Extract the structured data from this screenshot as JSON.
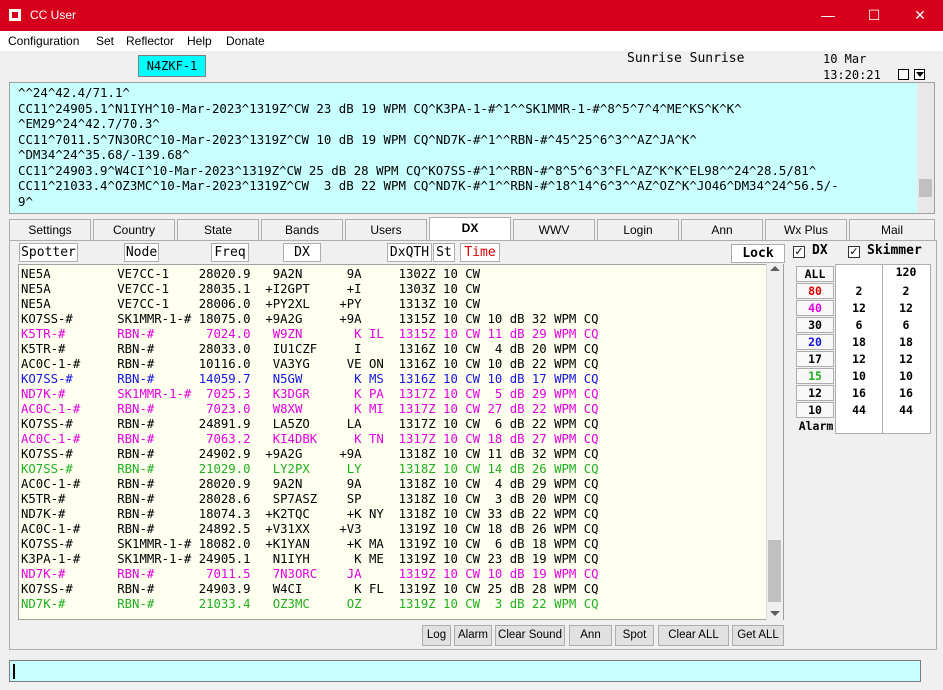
{
  "window": {
    "title": "CC User",
    "minimize": "—",
    "maximize": "☐",
    "close": "✕"
  },
  "menu": [
    "Configuration",
    "Set",
    "Reflector",
    "Help",
    "Donate"
  ],
  "callsign": "N4ZKF-1",
  "sun": "Sunrise Sunrise",
  "date": "10 Mar",
  "time": "13:20:21",
  "spot_log": [
    "^^24^42.4/71.1^",
    "CC11^24905.1^N1IYH^10-Mar-2023^1319Z^CW 23 dB 19 WPM CQ^K3PA-1-#^1^^SK1MMR-1-#^8^5^7^4^ME^KS^K^K^",
    "^EM29^24^42.7/70.3^",
    "CC11^7011.5^7N3ORC^10-Mar-2023^1319Z^CW 10 dB 19 WPM CQ^ND7K-#^1^^RBN-#^45^25^6^3^^AZ^JA^K^",
    "^DM34^24^35.68/-139.68^",
    "CC11^24903.9^W4CI^10-Mar-2023^1319Z^CW 25 dB 28 WPM CQ^KO7SS-#^1^^RBN-#^8^5^6^3^FL^AZ^K^K^EL98^^24^28.5/81^",
    "CC11^21033.4^OZ3MC^10-Mar-2023^1319Z^CW  3 dB 22 WPM CQ^ND7K-#^1^^RBN-#^18^14^6^3^^AZ^OZ^K^JO46^DM34^24^56.5/-",
    "9^"
  ],
  "tabs": [
    "Settings",
    "Country",
    "State",
    "Bands",
    "Users",
    "DX",
    "WWV",
    "Login",
    "Ann",
    "Wx Plus",
    "Mail"
  ],
  "active_tab": "DX",
  "headers": [
    "Spotter",
    "Node",
    "Freq",
    "DX",
    "DxQTH",
    "St",
    "Time"
  ],
  "lock": "Lock",
  "colors": {
    "black": "#000000",
    "magenta": "#e000e0",
    "blue": "#1414e0",
    "green": "#20b020",
    "time_header": "#e00000",
    "cyan": "#00ffff"
  },
  "rows": [
    {
      "spotter": "NE5A",
      "node": "VE7CC-1",
      "freq": "28020.9",
      "dx": " 9A2N",
      "qth": "9A",
      "st": "",
      "time": "1302Z",
      "band": "10",
      "mode": "CW",
      "extra": "",
      "color": "black"
    },
    {
      "spotter": "NE5A",
      "node": "VE7CC-1",
      "freq": "28035.1",
      "dx": "+I2GPT",
      "qth": "+I",
      "st": "",
      "time": "1303Z",
      "band": "10",
      "mode": "CW",
      "extra": "",
      "color": "black"
    },
    {
      "spotter": "NE5A",
      "node": "VE7CC-1",
      "freq": "28006.0",
      "dx": "+PY2XL",
      "qth": "+PY",
      "st": "",
      "time": "1313Z",
      "band": "10",
      "mode": "CW",
      "extra": "",
      "color": "black"
    },
    {
      "spotter": "KO7SS-#",
      "node": "SK1MMR-1-#",
      "freq": "18075.0",
      "dx": "+9A2G",
      "qth": "+9A",
      "st": "",
      "time": "1315Z",
      "band": "10",
      "mode": "CW",
      "extra": "10 dB 32 WPM CQ",
      "color": "black"
    },
    {
      "spotter": "K5TR-#",
      "node": "RBN-#",
      "freq": "7024.0",
      "dx": " W9ZN",
      "qth": "K",
      "st": "IL",
      "time": "1315Z",
      "band": "10",
      "mode": "CW",
      "extra": "11 dB 29 WPM CQ",
      "color": "magenta"
    },
    {
      "spotter": "K5TR-#",
      "node": "RBN-#",
      "freq": "28033.0",
      "dx": " IU1CZF",
      "qth": "I",
      "st": "",
      "time": "1316Z",
      "band": "10",
      "mode": "CW",
      "extra": " 4 dB 20 WPM CQ",
      "color": "black"
    },
    {
      "spotter": "AC0C-1-#",
      "node": "RBN-#",
      "freq": "10116.0",
      "dx": " VA3YG",
      "qth": "VE",
      "st": "ON",
      "time": "1316Z",
      "band": "10",
      "mode": "CW",
      "extra": "10 dB 22 WPM CQ",
      "color": "black"
    },
    {
      "spotter": "KO7SS-#",
      "node": "RBN-#",
      "freq": "14059.7",
      "dx": " N5GW",
      "qth": "K",
      "st": "MS",
      "time": "1316Z",
      "band": "10",
      "mode": "CW",
      "extra": "10 dB 17 WPM CQ",
      "color": "blue"
    },
    {
      "spotter": "ND7K-#",
      "node": "SK1MMR-1-#",
      "freq": "7025.3",
      "dx": " K3DGR",
      "qth": "K",
      "st": "PA",
      "time": "1317Z",
      "band": "10",
      "mode": "CW",
      "extra": " 5 dB 29 WPM CQ",
      "color": "magenta"
    },
    {
      "spotter": "AC0C-1-#",
      "node": "RBN-#",
      "freq": "7023.0",
      "dx": " W8XW",
      "qth": "K",
      "st": "MI",
      "time": "1317Z",
      "band": "10",
      "mode": "CW",
      "extra": "27 dB 22 WPM CQ",
      "color": "magenta"
    },
    {
      "spotter": "KO7SS-#",
      "node": "RBN-#",
      "freq": "24891.9",
      "dx": " LA5ZO",
      "qth": "LA",
      "st": "",
      "time": "1317Z",
      "band": "10",
      "mode": "CW",
      "extra": " 6 dB 22 WPM CQ",
      "color": "black"
    },
    {
      "spotter": "AC0C-1-#",
      "node": "RBN-#",
      "freq": "7063.2",
      "dx": " KI4DBK",
      "qth": "K",
      "st": "TN",
      "time": "1317Z",
      "band": "10",
      "mode": "CW",
      "extra": "18 dB 27 WPM CQ",
      "color": "magenta"
    },
    {
      "spotter": "KO7SS-#",
      "node": "RBN-#",
      "freq": "24902.9",
      "dx": "+9A2G",
      "qth": "+9A",
      "st": "",
      "time": "1318Z",
      "band": "10",
      "mode": "CW",
      "extra": "11 dB 32 WPM CQ",
      "color": "black"
    },
    {
      "spotter": "KO7SS-#",
      "node": "RBN-#",
      "freq": "21029.0",
      "dx": " LY2PX",
      "qth": "LY",
      "st": "",
      "time": "1318Z",
      "band": "10",
      "mode": "CW",
      "extra": "14 dB 26 WPM CQ",
      "color": "green"
    },
    {
      "spotter": "AC0C-1-#",
      "node": "RBN-#",
      "freq": "28020.9",
      "dx": " 9A2N",
      "qth": "9A",
      "st": "",
      "time": "1318Z",
      "band": "10",
      "mode": "CW",
      "extra": " 4 dB 29 WPM CQ",
      "color": "black"
    },
    {
      "spotter": "K5TR-#",
      "node": "RBN-#",
      "freq": "28028.6",
      "dx": " SP7ASZ",
      "qth": "SP",
      "st": "",
      "time": "1318Z",
      "band": "10",
      "mode": "CW",
      "extra": " 3 dB 20 WPM CQ",
      "color": "black"
    },
    {
      "spotter": "ND7K-#",
      "node": "RBN-#",
      "freq": "18074.3",
      "dx": "+K2TQC",
      "qth": "+K",
      "st": "NY",
      "time": "1318Z",
      "band": "10",
      "mode": "CW",
      "extra": "33 dB 22 WPM CQ",
      "color": "black"
    },
    {
      "spotter": "AC0C-1-#",
      "node": "RBN-#",
      "freq": "24892.5",
      "dx": "+V31XX",
      "qth": "+V3",
      "st": "",
      "time": "1319Z",
      "band": "10",
      "mode": "CW",
      "extra": "18 dB 26 WPM CQ",
      "color": "black"
    },
    {
      "spotter": "KO7SS-#",
      "node": "SK1MMR-1-#",
      "freq": "18082.0",
      "dx": "+K1YAN",
      "qth": "+K",
      "st": "MA",
      "time": "1319Z",
      "band": "10",
      "mode": "CW",
      "extra": " 6 dB 18 WPM CQ",
      "color": "black"
    },
    {
      "spotter": "K3PA-1-#",
      "node": "SK1MMR-1-#",
      "freq": "24905.1",
      "dx": " N1IYH",
      "qth": "K",
      "st": "ME",
      "time": "1319Z",
      "band": "10",
      "mode": "CW",
      "extra": "23 dB 19 WPM CQ",
      "color": "black"
    },
    {
      "spotter": "ND7K-#",
      "node": "RBN-#",
      "freq": "7011.5",
      "dx": " 7N3ORC",
      "qth": "JA",
      "st": "",
      "time": "1319Z",
      "band": "10",
      "mode": "CW",
      "extra": "10 dB 19 WPM CQ",
      "color": "magenta"
    },
    {
      "spotter": "KO7SS-#",
      "node": "RBN-#",
      "freq": "24903.9",
      "dx": " W4CI",
      "qth": "K",
      "st": "FL",
      "time": "1319Z",
      "band": "10",
      "mode": "CW",
      "extra": "25 dB 28 WPM CQ",
      "color": "black"
    },
    {
      "spotter": "ND7K-#",
      "node": "RBN-#",
      "freq": "21033.4",
      "dx": " OZ3MC",
      "qth": "OZ",
      "st": "",
      "time": "1319Z",
      "band": "10",
      "mode": "CW",
      "extra": " 3 dB 22 WPM CQ",
      "color": "green"
    }
  ],
  "filters": {
    "dx_label": "DX",
    "dx_checked": true,
    "skimmer_label": "Skimmer",
    "skimmer_checked": true,
    "check_mark": "✓"
  },
  "bands": [
    {
      "label": "ALL",
      "color": "black",
      "dx": "",
      "skim": "120"
    },
    {
      "label": "80",
      "color": "red",
      "dx": "2",
      "skim": "2"
    },
    {
      "label": "40",
      "color": "magenta",
      "dx": "12",
      "skim": "12"
    },
    {
      "label": "30",
      "color": "black",
      "dx": "6",
      "skim": "6"
    },
    {
      "label": "20",
      "color": "blue",
      "dx": "18",
      "skim": "18"
    },
    {
      "label": "17",
      "color": "black",
      "dx": "12",
      "skim": "12"
    },
    {
      "label": "15",
      "color": "green",
      "dx": "10",
      "skim": "10"
    },
    {
      "label": "12",
      "color": "black",
      "dx": "16",
      "skim": "16"
    },
    {
      "label": "10",
      "color": "black",
      "dx": "44",
      "skim": "44"
    },
    {
      "label": "Alarm",
      "color": "black",
      "dx": "",
      "skim": ""
    }
  ],
  "bottom_buttons": [
    "Log",
    "Alarm",
    "Clear Sound",
    "Ann",
    "Spot",
    "Clear ALL",
    "Get ALL"
  ]
}
